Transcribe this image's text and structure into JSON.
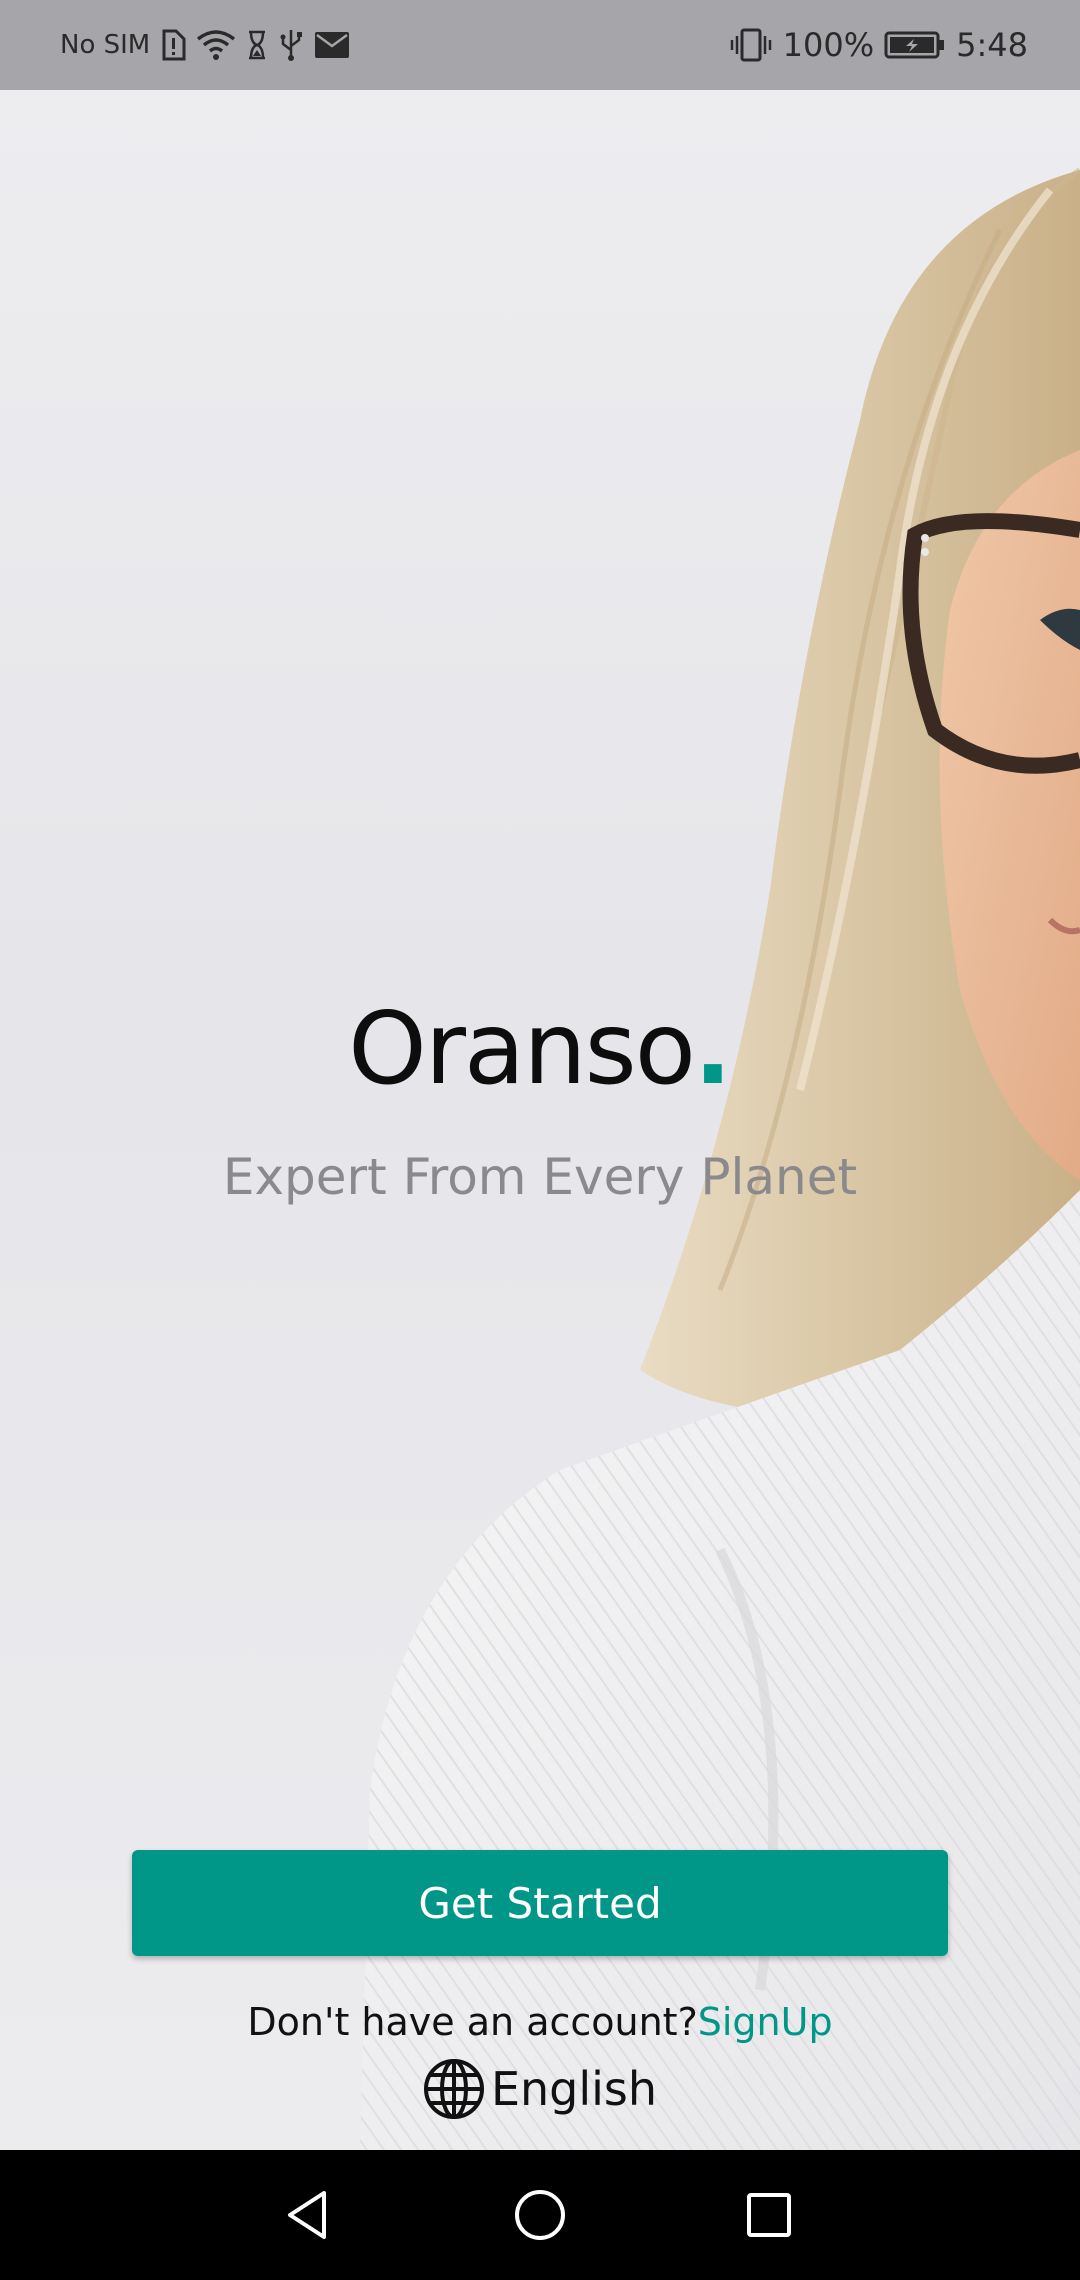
{
  "status_bar": {
    "carrier": "No SIM",
    "battery_percent": "100%",
    "time": "5:48",
    "icons": [
      "sim-alert-icon",
      "wifi-icon",
      "hourglass-icon",
      "usb-icon",
      "mail-icon",
      "vibrate-icon",
      "battery-charging-icon"
    ]
  },
  "brand": {
    "name": "Oranso",
    "dot": ".",
    "tagline": "Expert From Every Planet",
    "accent_color": "#009688"
  },
  "actions": {
    "get_started_label": "Get Started",
    "no_account_text": "Don't have an account?",
    "signup_label": "SignUp"
  },
  "language": {
    "icon": "globe-icon",
    "label": "English"
  },
  "nav_bar": {
    "icons": [
      "back-icon",
      "home-icon",
      "recents-icon"
    ]
  }
}
